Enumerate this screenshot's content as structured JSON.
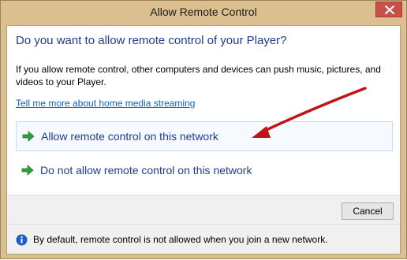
{
  "window": {
    "title": "Allow Remote Control",
    "close_icon": "close-icon"
  },
  "dialog": {
    "heading": "Do you want to allow remote control of your Player?",
    "description_lines": [
      "If you allow remote control, other computers and devices can push music, pictures, and",
      "videos to your Player."
    ],
    "help_link": "Tell me more about home media streaming",
    "options": [
      {
        "label": "Allow remote control on this network",
        "icon": "green-arrow-icon",
        "highlighted": true
      },
      {
        "label": "Do not allow remote control on this network",
        "icon": "green-arrow-icon",
        "highlighted": false
      }
    ],
    "cancel_label": "Cancel",
    "footnote": "By default, remote control is not allowed when you join a new network.",
    "footnote_icon": "info-icon"
  },
  "colors": {
    "heading": "#1f3c8c",
    "link": "#0066cc",
    "frame": "#dcbf8e",
    "close_button": "#c7504b",
    "annotation_arrow": "#c0141c",
    "command_arrow": "#2e9e3e"
  }
}
